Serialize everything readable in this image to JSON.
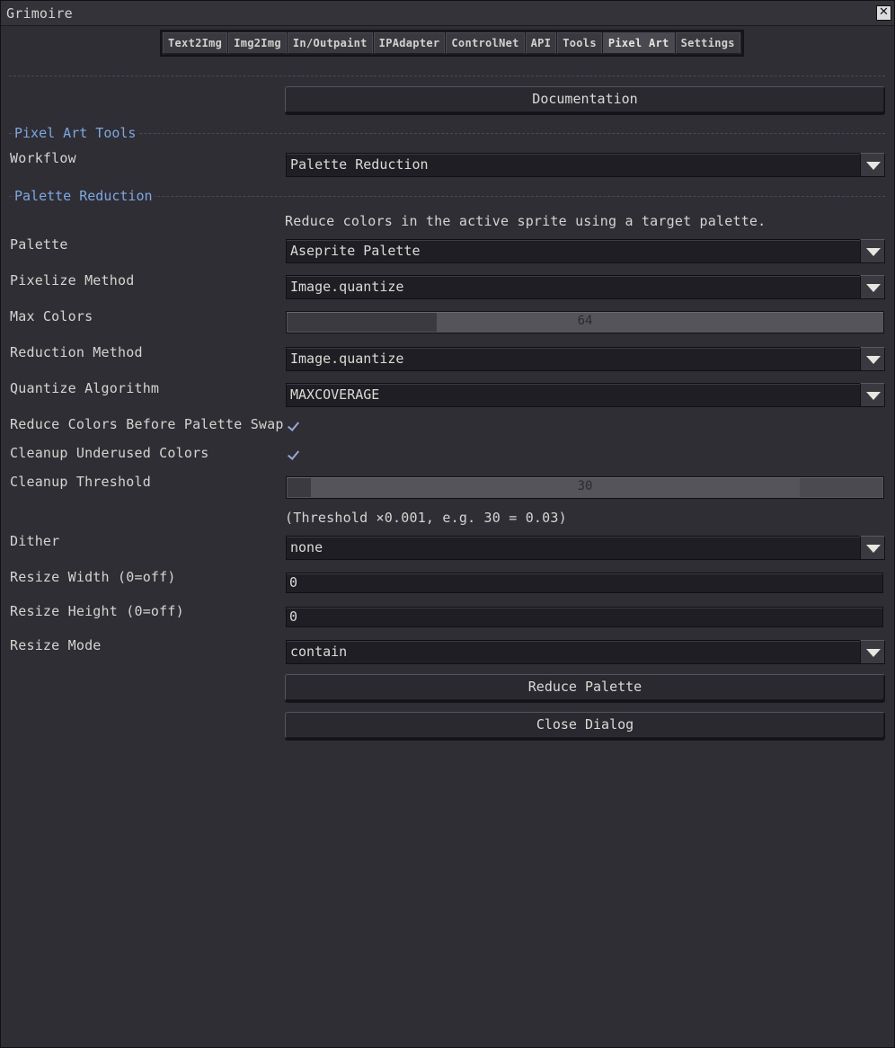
{
  "window": {
    "title": "Grimoire"
  },
  "tabs": [
    {
      "label": "Text2Img"
    },
    {
      "label": "Img2Img"
    },
    {
      "label": "In/Outpaint"
    },
    {
      "label": "IPAdapter"
    },
    {
      "label": "ControlNet"
    },
    {
      "label": "API"
    },
    {
      "label": "Tools"
    },
    {
      "label": "Pixel Art",
      "active": true
    },
    {
      "label": "Settings"
    }
  ],
  "documentation_button": "Documentation",
  "sections": {
    "pixel_art_tools": "Pixel Art Tools",
    "palette_reduction": "Palette Reduction"
  },
  "workflow": {
    "label": "Workflow",
    "value": "Palette Reduction"
  },
  "description": "Reduce colors in the active sprite using a target palette.",
  "palette": {
    "label": "Palette",
    "value": "Aseprite Palette"
  },
  "pixelize_method": {
    "label": "Pixelize Method",
    "value": "Image.quantize"
  },
  "max_colors": {
    "label": "Max Colors",
    "value": "64",
    "fraction": 0.25
  },
  "reduction_method": {
    "label": "Reduction Method",
    "value": "Image.quantize"
  },
  "quantize_algorithm": {
    "label": "Quantize Algorithm",
    "value": "MAXCOVERAGE"
  },
  "reduce_before_swap": {
    "label": "Reduce Colors Before Palette Swap",
    "checked": true
  },
  "cleanup_underused": {
    "label": "Cleanup Underused Colors",
    "checked": true
  },
  "cleanup_threshold": {
    "label": "Cleanup Threshold",
    "value": "30",
    "fraction": 0.04
  },
  "threshold_note": "(Threshold ×0.001, e.g. 30 = 0.03)",
  "dither": {
    "label": "Dither",
    "value": "none"
  },
  "resize_width": {
    "label": "Resize Width (0=off)",
    "value": "0"
  },
  "resize_height": {
    "label": "Resize Height (0=off)",
    "value": "0"
  },
  "resize_mode": {
    "label": "Resize Mode",
    "value": "contain"
  },
  "reduce_palette_button": "Reduce Palette",
  "close_dialog_button": "Close Dialog",
  "colors": {
    "accent": "#7ea7e0",
    "background": "#2f2e35"
  }
}
